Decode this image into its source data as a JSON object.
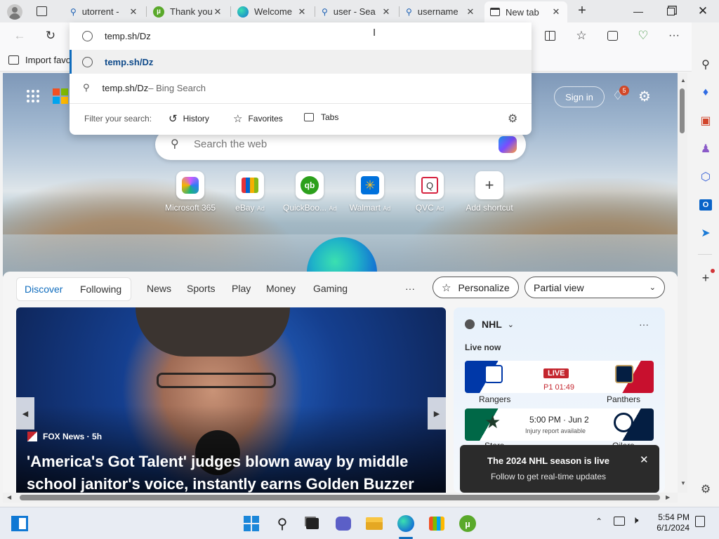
{
  "tabs": [
    {
      "title": "utorrent -",
      "icon": "search-icon"
    },
    {
      "title": "Thank you",
      "icon": "utorrent-icon"
    },
    {
      "title": "Welcome",
      "icon": "edge-icon"
    },
    {
      "title": "user - Sea",
      "icon": "search-icon"
    },
    {
      "title": "username",
      "icon": "search-icon"
    },
    {
      "title": "New tab",
      "icon": "newtab-icon"
    }
  ],
  "favbar": {
    "import_label": "Import favo"
  },
  "omnibox": {
    "value": "temp.sh/Dz",
    "suggestions": [
      {
        "text": "temp.sh/Dz",
        "sub": ""
      },
      {
        "text": "temp.sh/Dz",
        "sub": " – Bing Search"
      }
    ],
    "filter_label": "Filter your search:",
    "filters": [
      "History",
      "Favorites",
      "Tabs"
    ]
  },
  "newtab": {
    "signin_label": "Sign in",
    "notif_count": "5",
    "search_placeholder": "Search the web",
    "quicklinks": [
      {
        "label": "Microsoft 365",
        "ad": ""
      },
      {
        "label": "eBay",
        "ad": "Ad"
      },
      {
        "label": "QuickBoo...",
        "ad": "Ad"
      },
      {
        "label": "Walmart",
        "ad": "Ad"
      },
      {
        "label": "QVC",
        "ad": "Ad"
      },
      {
        "label": "Add shortcut",
        "ad": ""
      }
    ],
    "nav": {
      "discover": "Discover",
      "following": "Following",
      "items": [
        "News",
        "Sports",
        "Play",
        "Money",
        "Gaming"
      ],
      "more": "···",
      "personalize": "Personalize",
      "view": "Partial view"
    },
    "article": {
      "source": "FOX News · 5h",
      "headline": "'America's Got Talent' judges blown away by middle school janitor's voice, instantly earns Golden Buzzer"
    },
    "nhl": {
      "title": "NHL",
      "live_now": "Live now",
      "games": [
        {
          "home": "Rangers",
          "away": "Panthers",
          "status": "LIVE",
          "time": "P1 01:49",
          "note": ""
        },
        {
          "home": "Stars",
          "away": "Oilers",
          "status": "",
          "time": "5:00 PM · Jun 2",
          "note": "Injury report available"
        }
      ],
      "toast_title": "The 2024 NHL season is live",
      "toast_body": "Follow to get real-time updates"
    }
  },
  "taskbar": {
    "time": "5:54 PM",
    "date": "6/1/2024"
  },
  "colors": {
    "accent": "#0f6cbd",
    "live": "#c4262e",
    "nhl_blue": "#1f56b8"
  }
}
